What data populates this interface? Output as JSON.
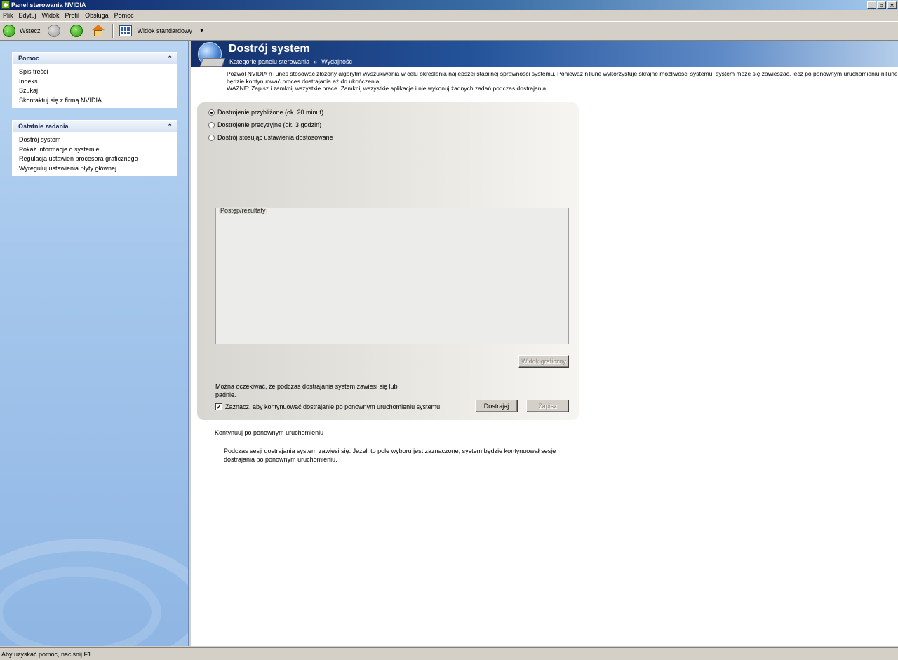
{
  "window": {
    "title": "Panel sterowania NVIDIA",
    "controls": {
      "minimize": "_",
      "restore": "▫",
      "close": "×"
    }
  },
  "menu": {
    "items": [
      "Plik",
      "Edytuj",
      "Widok",
      "Profil",
      "Obsługa",
      "Pomoc"
    ]
  },
  "toolbar": {
    "back_label": "Wstecz",
    "view_label": "Widok standardowy",
    "dropdown_arrow": "▼"
  },
  "sidebar": {
    "help": {
      "title": "Pomoc",
      "items": [
        "Spis treści",
        "Indeks",
        "Szukaj",
        "Skontaktuj się z firmą NVIDIA"
      ]
    },
    "recent": {
      "title": "Ostatnie zadania",
      "items": [
        "Dostrój system",
        "Pokaż informacje o systemie",
        "Regulacja ustawień procesora graficznego",
        "Wyreguluj ustawienia płyty głównej"
      ]
    },
    "collapse_glyph": "⌃"
  },
  "header": {
    "title": "Dostrój system",
    "breadcrumb_category": "Kategorie panelu sterowania",
    "breadcrumb_separator": "»",
    "breadcrumb_current": "Wydajność"
  },
  "description": {
    "line1": "Pozwól NVIDIA nTunes stosować złożony algorytm wyszukiwania w celu określenia najlepszej stabilnej sprawności systemu.  Ponieważ nTune wykorzystuje skrajne możliwości systemu, system może się zawieszać, lecz po ponownym uruchomieniu nTune",
    "line2": "będzie kontynuować proces dostrajania aż do ukończenia.",
    "line3": "WAŻNE: Zapisz i zamknij wszystkie prace.  Zamknij wszystkie aplikacje i nie wykonuj żadnych zadań podczas dostrajania."
  },
  "tuning": {
    "options": [
      {
        "label": "Dostrojenie przybliżone (ok. 20 minut)",
        "selected": true
      },
      {
        "label": "Dostrojenie precyzyjne (ok. 3 godzin)",
        "selected": false
      },
      {
        "label": "Dostrój stosując ustawienia dostosowane",
        "selected": false
      }
    ],
    "progress_legend": "Postęp/rezultaty",
    "graph_button": "Widok graficzny",
    "warning": "Można oczekiwać, że podczas dostrajania system zawiesi się lub padnie.",
    "continue_checkbox": "Zaznacz, aby kontynuować dostrajanie po ponownym uruchomieniu systemu",
    "continue_checked": true,
    "check_glyph": "✓",
    "tune_button": "Dostrajaj",
    "save_button": "Zapisz"
  },
  "info": {
    "title": "Kontynuuj po ponownym uruchomieniu",
    "text": "Podczas sesji dostrajania system zawiesi się.  Jeżeli to pole wyboru jest zaznaczone, system będzie kontynuował sesję dostrajania po ponownym uruchomieniu."
  },
  "statusbar": {
    "text": "Aby uzyskać pomoc, naciśnij F1"
  }
}
